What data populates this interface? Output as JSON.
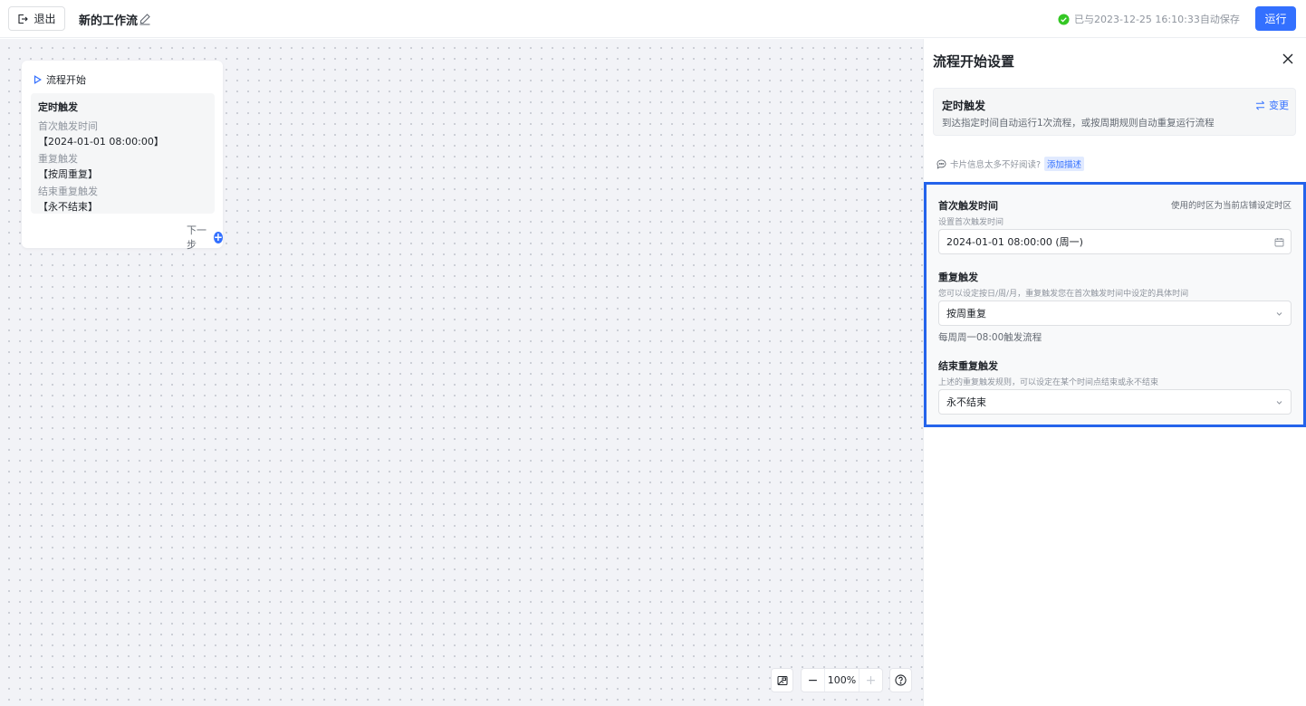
{
  "header": {
    "exit_label": "退出",
    "workflow_title": "新的工作流",
    "save_status": "已与2023-12-25 16:10:33自动保存",
    "run_label": "运行"
  },
  "node": {
    "header_label": "流程开始",
    "trigger_title": "定时触发",
    "first_time_label": "首次触发时间",
    "first_time_value": "【2024-01-01 08:00:00】",
    "repeat_label": "重复触发",
    "repeat_value": "【按周重复】",
    "end_label": "结束重复触发",
    "end_value": "【永不结束】",
    "next_step_label": "下一步"
  },
  "canvas_controls": {
    "zoom_value": "100%",
    "zoom_out_label": "−",
    "zoom_in_label": "+"
  },
  "panel": {
    "title": "流程开始设置",
    "trigger_type": "定时触发",
    "trigger_desc": "到达指定时间自动运行1次流程，或按周期规则自动重复运行流程",
    "change_label": "变更",
    "hint_text": "卡片信息太多不好阅读?",
    "add_desc_label": "添加描述",
    "first_time": {
      "title": "首次触发时间",
      "subtitle": "设置首次触发时间",
      "tz_note": "使用的时区为当前店铺设定时区",
      "value": "2024-01-01 08:00:00 (周一)"
    },
    "repeat": {
      "title": "重复触发",
      "subtitle": "您可以设定按日/周/月，重复触发您在首次触发时间中设定的具体时间",
      "value": "按周重复",
      "rule_text": "每周周一08:00触发流程"
    },
    "end": {
      "title": "结束重复触发",
      "subtitle": "上述的重复触发规则，可以设定在某个时间点结束或永不结束",
      "value": "永不结束"
    }
  },
  "colors": {
    "accent": "#3370ff",
    "highlight_border": "#2463eb",
    "success": "#34c724"
  },
  "icons": [
    "exit-icon",
    "edit-icon",
    "check-circle-icon",
    "play-icon",
    "plus-circle-icon",
    "minimap-icon",
    "help-icon",
    "close-icon",
    "swap-icon",
    "chat-icon",
    "calendar-icon",
    "chevron-down-icon"
  ]
}
